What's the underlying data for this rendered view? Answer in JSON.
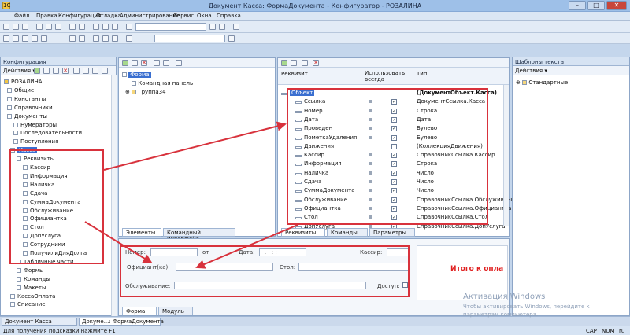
{
  "window": {
    "title": "Документ Касса: ФормаДокумента - Конфигуратор - РОЗАЛИНА",
    "minimize": "–",
    "maximize": "□",
    "close": "✕"
  },
  "menu": [
    "Файл",
    "Правка",
    "Конфигурация",
    "Отладка",
    "Администрирование",
    "Сервис",
    "Окна",
    "Справка"
  ],
  "config_panel": {
    "title": "Конфигурация",
    "actions": "Действия ▾",
    "tree": [
      "РОЗАЛИНА",
      "Общие",
      "Константы",
      "Справочники",
      "Документы",
      "Нумераторы",
      "Последовательности",
      "Поступления",
      "Касса",
      "Реквизиты",
      "Кассир",
      "Информация",
      "Наличка",
      "Сдача",
      "СуммаДокумента",
      "Обслуживание",
      "Официантка",
      "Стол",
      "ДопУслуга",
      "Сотрудники",
      "ПолучилиДляДолга",
      "Табличные части",
      "Формы",
      "Команды",
      "Макеты",
      "КассаОплата",
      "Списание"
    ]
  },
  "form_tree": {
    "items": [
      "Форма",
      "Командная панель",
      "Группа34"
    ],
    "tabs": [
      "Элементы",
      "Командный интерфейс"
    ]
  },
  "attributes": {
    "col_attr": "Реквизит",
    "col_use": "Использовать всегда",
    "col_type": "Тип",
    "rows": [
      {
        "name": "Объект",
        "type": "(ДокументОбъект.Касса)",
        "checked": false
      },
      {
        "name": "Ссылка",
        "type": "ДокументСсылка.Касса",
        "checked": true
      },
      {
        "name": "Номер",
        "type": "Строка",
        "checked": true
      },
      {
        "name": "Дата",
        "type": "Дата",
        "checked": true
      },
      {
        "name": "Проведен",
        "type": "Булево",
        "checked": true
      },
      {
        "name": "ПометкаУдаления",
        "type": "Булево",
        "checked": true
      },
      {
        "name": "Движения",
        "type": "(КоллекцияДвижения)",
        "checked": false
      },
      {
        "name": "Кассир",
        "type": "СправочникСсылка.Кассир",
        "checked": true
      },
      {
        "name": "Информация",
        "type": "Строка",
        "checked": true
      },
      {
        "name": "Наличка",
        "type": "Число",
        "checked": true
      },
      {
        "name": "Сдача",
        "type": "Число",
        "checked": true
      },
      {
        "name": "СуммаДокумента",
        "type": "Число",
        "checked": true
      },
      {
        "name": "Обслуживание",
        "type": "СправочникСсылка.Обслуживание",
        "checked": true
      },
      {
        "name": "Официантка",
        "type": "СправочникСсылка.Официантка",
        "checked": true
      },
      {
        "name": "Стол",
        "type": "СправочникСсылка.Стол",
        "checked": true
      },
      {
        "name": "ДопУслуга",
        "type": "СправочникСсылка.ДопУслуга",
        "checked": true
      }
    ],
    "tabs": [
      "Реквизиты",
      "Команды",
      "Параметры"
    ]
  },
  "templates_panel": {
    "title": "Шаблоны текста",
    "actions": "Действия ▾",
    "items": [
      "Стандартные"
    ]
  },
  "form_preview": {
    "number_label": "Номер:",
    "date_label": "от",
    "date_label2": "Дата:",
    "date_value": ". .  :  :",
    "cashier_label": "Кассир:",
    "waiter_label": "Официант(ка):",
    "table_label": "Стол:",
    "service_label": "Обслуживание:",
    "extra_label": "Доступ:",
    "total_text": "Итого к опла",
    "tabs": [
      "Форма",
      "Модуль"
    ]
  },
  "taskbar": [
    "Документ Касса",
    "Докуме...: ФормаДокумента"
  ],
  "status": {
    "hint": "Для получения подсказки нажмите F1",
    "cap": "CAP",
    "num": "NUM",
    "lang": "ru"
  },
  "watermark": {
    "line1": "Активация Windows",
    "line2": "Чтобы активировать Windows, перейдите к",
    "line3": "параметрам компьютера."
  },
  "colors": {
    "highlight_red": "#d8323c",
    "selection_blue": "#3a6fd0",
    "total_red": "#e02020"
  }
}
